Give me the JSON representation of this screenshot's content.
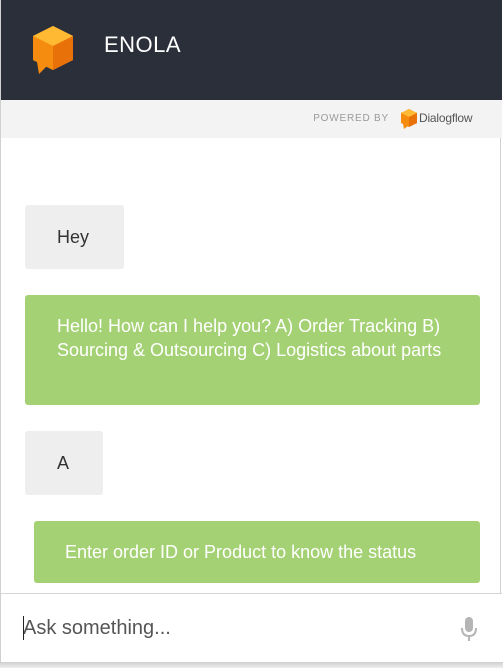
{
  "header": {
    "title": "ENOLA",
    "logo_icon": "orange-cube-chat-icon",
    "background_color": "#2b2f3a"
  },
  "powered_by": {
    "label": "POWERED BY",
    "brand": "Dialogflow",
    "brand_icon": "dialogflow-icon"
  },
  "messages": [
    {
      "sender": "user",
      "text": "Hey"
    },
    {
      "sender": "bot",
      "text": "Hello! How can I help you? A) Order Tracking B) Sourcing & Outsourcing C) Logistics about parts"
    },
    {
      "sender": "user",
      "text": "A"
    },
    {
      "sender": "bot",
      "text": "Enter order ID or Product to know the status"
    }
  ],
  "composer": {
    "placeholder": "Ask something...",
    "value": "",
    "mic_icon": "microphone-icon"
  },
  "colors": {
    "bot_bubble": "#a5d175",
    "user_bubble": "#eeeeee",
    "accent_orange": "#f5820b"
  }
}
